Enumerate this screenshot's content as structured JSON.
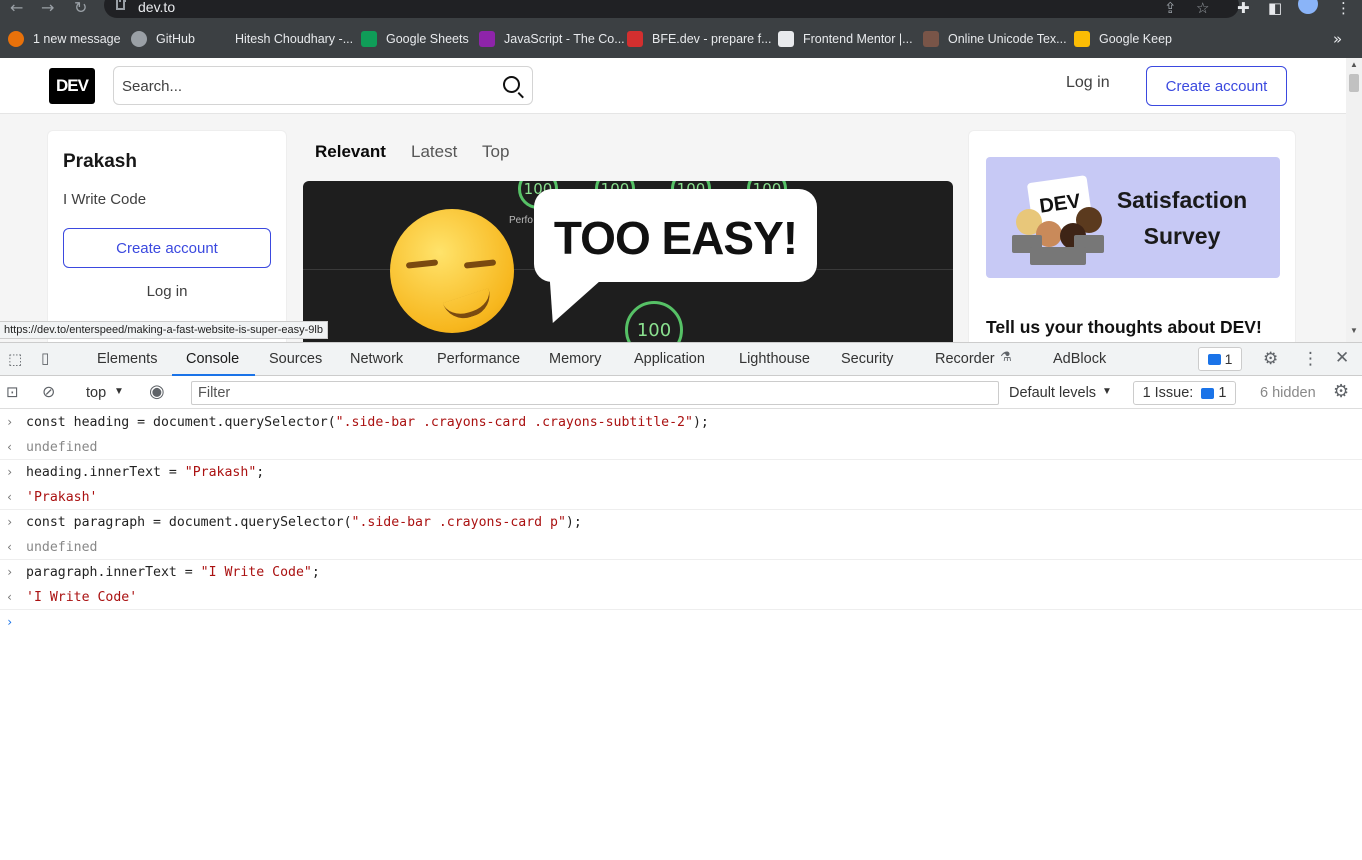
{
  "browser": {
    "url": "dev.to",
    "bookmarks": [
      {
        "label": "1 new message",
        "color": "#e8710a"
      },
      {
        "label": "GitHub",
        "color": "#9aa0a6"
      },
      {
        "label": "Hitesh Choudhary -...",
        "color": "#3c4043"
      },
      {
        "label": "Google Sheets",
        "color": "#0f9d58"
      },
      {
        "label": "JavaScript - The Co...",
        "color": "#8e24aa"
      },
      {
        "label": "BFE.dev - prepare f...",
        "color": "#d32f2f"
      },
      {
        "label": "Frontend Mentor |...",
        "color": "#e8eaed"
      },
      {
        "label": "Online Unicode Tex...",
        "color": "#795548"
      },
      {
        "label": "Google Keep",
        "color": "#fbbc04"
      }
    ],
    "more_bookmarks": "»",
    "status_url": "https://dev.to/enterspeed/making-a-fast-website-is-super-easy-9lb"
  },
  "site": {
    "logo": "DEV",
    "search_placeholder": "Search...",
    "login": "Log in",
    "create_account": "Create account",
    "sidebar": {
      "title": "Prakash",
      "subtitle": "I Write Code",
      "create_account": "Create account",
      "login": "Log in"
    },
    "feed_tabs": [
      "Relevant",
      "Latest",
      "Top"
    ],
    "cover": {
      "bubble_text": "TOO EASY!",
      "gauge_value": "100",
      "perf_label": "Perfo"
    },
    "right_card": {
      "sign_text": "DEV",
      "survey_title": "Satisfaction Survey",
      "heading": "Tell us your thoughts about DEV!"
    }
  },
  "devtools": {
    "tabs": [
      "Elements",
      "Console",
      "Sources",
      "Network",
      "Performance",
      "Memory",
      "Application",
      "Lighthouse",
      "Security",
      "Recorder",
      "AdBlock"
    ],
    "active_tab": "Console",
    "message_count": "1",
    "context": "top",
    "filter_placeholder": "Filter",
    "levels": "Default levels",
    "issues_label": "1 Issue:",
    "issues_count": "1",
    "hidden": "6 hidden",
    "lines": [
      {
        "kind": "input",
        "pre": "const heading = document.querySelector(",
        "str": "\".side-bar .crayons-card .crayons-subtitle-2\"",
        "post": ");"
      },
      {
        "kind": "result-undef",
        "text": "undefined"
      },
      {
        "kind": "input",
        "pre": "heading.innerText = ",
        "str": "\"Prakash\"",
        "post": ";"
      },
      {
        "kind": "result-str",
        "text": "'Prakash'"
      },
      {
        "kind": "input",
        "pre": "const paragraph = document.querySelector(",
        "str": "\".side-bar .crayons-card p\"",
        "post": ");"
      },
      {
        "kind": "result-undef",
        "text": "undefined"
      },
      {
        "kind": "input",
        "pre": "paragraph.innerText = ",
        "str": "\"I Write Code\"",
        "post": ";"
      },
      {
        "kind": "result-str",
        "text": "'I Write Code'"
      }
    ]
  }
}
